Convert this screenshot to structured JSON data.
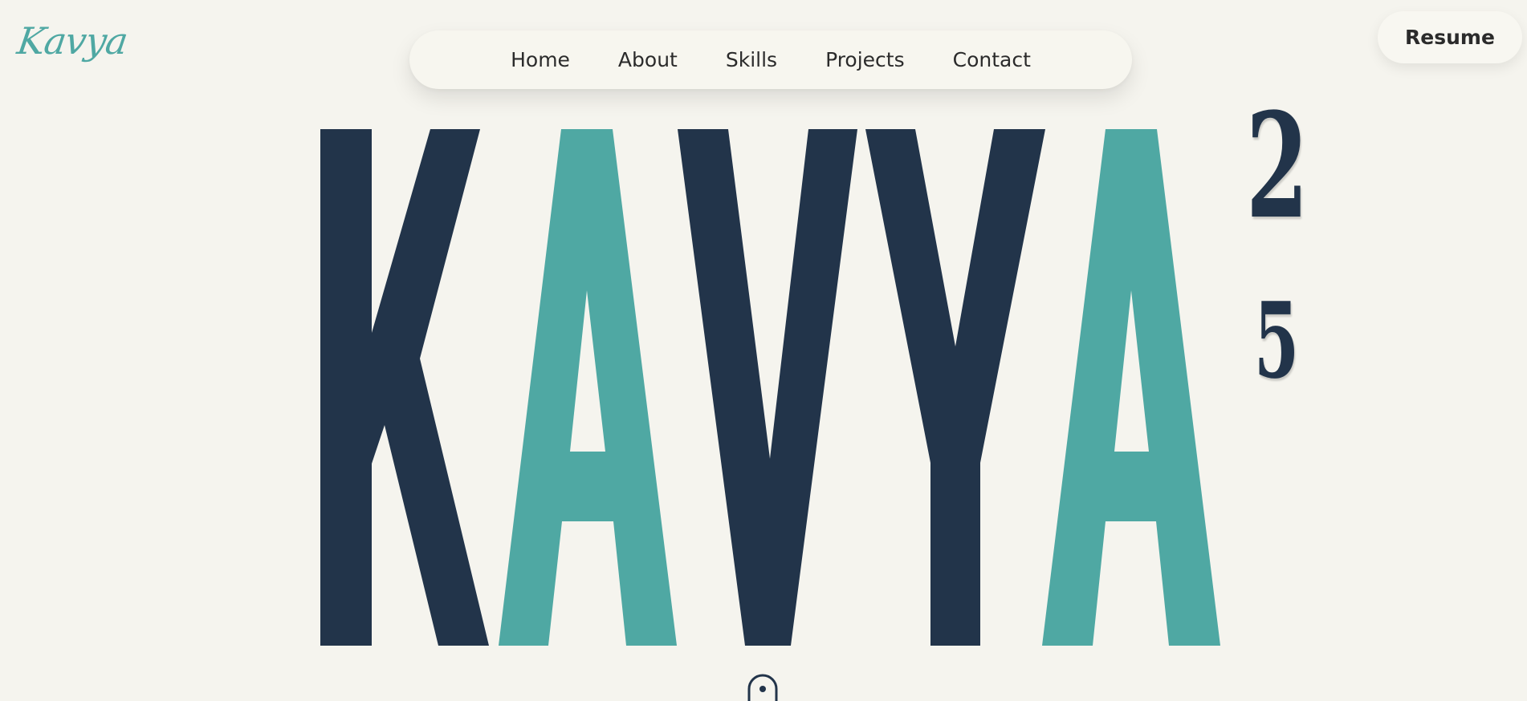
{
  "header": {
    "logo_text": "Kavya",
    "resume_label": "Resume"
  },
  "nav": {
    "items": [
      {
        "label": "Home"
      },
      {
        "label": "About"
      },
      {
        "label": "Skills"
      },
      {
        "label": "Projects"
      },
      {
        "label": "Contact"
      }
    ]
  },
  "hero": {
    "letters": [
      "K",
      "A",
      "V",
      "Y",
      "A"
    ],
    "year_top": "2",
    "year_bottom": "5"
  },
  "icons": {
    "scroll": "mouse-scroll-icon"
  },
  "colors": {
    "background": "#f5f4ee",
    "navy": "#22344a",
    "teal": "#4fa8a3",
    "text": "#2b2b2b"
  }
}
